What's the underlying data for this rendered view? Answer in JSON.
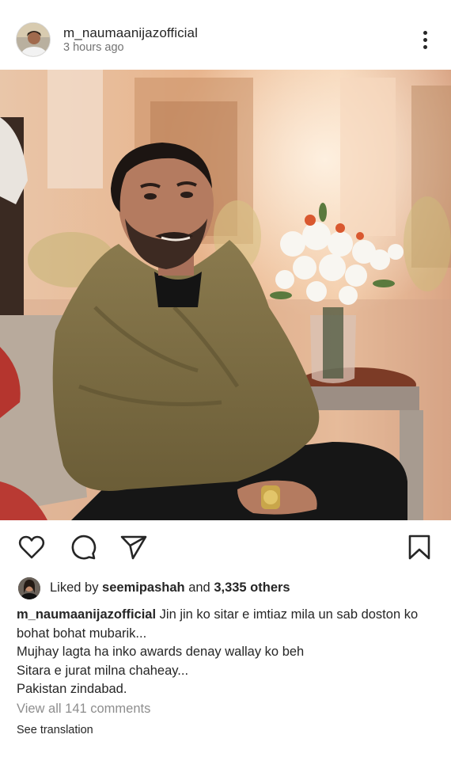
{
  "post": {
    "username": "m_naumaanijazofficial",
    "time": "3 hours ago"
  },
  "icons": {
    "more": "more-vertical-icon",
    "like": "heart-icon",
    "comment": "comment-icon",
    "share": "send-icon",
    "save": "bookmark-icon"
  },
  "likes": {
    "prefix": "Liked by ",
    "user": "seemipashah",
    "middle": " and ",
    "count": "3,335 others"
  },
  "caption": {
    "username": "m_naumaanijazofficial",
    "lines": [
      " Jin jin ko sitar e imtiaz mila un sab doston ko",
      "bohat bohat mubarik...",
      "Mujhay lagta ha inko awards denay wallay ko beh",
      "Sitara e jurat milna chaheay...",
      "Pakistan zindabad."
    ]
  },
  "comments": {
    "view_all": "View all 141 comments"
  },
  "translation": {
    "label": "See translation"
  },
  "colors": {
    "text": "#262626",
    "muted": "#737373",
    "comments": "#8e8e8e"
  }
}
